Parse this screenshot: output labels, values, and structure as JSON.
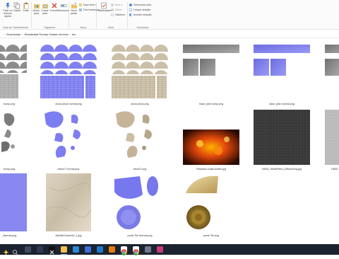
{
  "ribbon": {
    "clipboard": {
      "pin_label": "Fixar no\nAcesso\nrápido",
      "copy_label": "Copiar",
      "paste_label": "Colar",
      "group_label": "Área de Transferência"
    },
    "organize": {
      "move_to": "Mover\npara",
      "copy_to": "Copiar\npara",
      "delete": "Excluir",
      "rename": "Renomear",
      "group_label": "Organizar"
    },
    "new": {
      "new_folder": "Nova\npasta",
      "new_item": "Novo item ▾",
      "easy_access": "Fácil acesso ▾",
      "group_label": "Novo"
    },
    "open": {
      "properties": "Propriedades",
      "open": "Abrir ▾",
      "edit": "Editar",
      "history": "Histórico",
      "group_label": "Abrir"
    },
    "select": {
      "select_all": "Selecionar tudo",
      "select_none": "Limpar seleção",
      "invert": "Inverter seleção",
      "group_label": "Selecionar"
    }
  },
  "breadcrumbs": [
    "Downloads",
    "Residential Roman Garden Archviz",
    "tex"
  ],
  "files": [
    {
      "name": "bump.png",
      "kind": "arch-gray"
    },
    {
      "name": "arcos pisos normal.png",
      "kind": "arch-normal"
    },
    {
      "name": "arcos pisos.png",
      "kind": "arch-beige"
    },
    {
      "name": "base_pilar bump.png",
      "kind": "pillar-gray"
    },
    {
      "name": "base_pilar normal.png",
      "kind": "pillar-normal"
    },
    {
      "name": "",
      "kind": "pillar-gray-cut"
    },
    {
      "name": "bump.png",
      "kind": "deco-gray"
    },
    {
      "name": "deco07 normal.png",
      "kind": "deco-normal"
    },
    {
      "name": "deco07.png",
      "kind": "deco-beige"
    },
    {
      "name": "Fireplace-coals-bonfire.jpg",
      "kind": "fire"
    },
    {
      "name": "KB3D_MetalPitted_DiffuseGray.jpg",
      "kind": "metal-dark"
    },
    {
      "name": "KB3D",
      "kind": "metal-light"
    },
    {
      "name": "_Normal.png",
      "kind": "marble-normal"
    },
    {
      "name": "MarbleColumns2_1.jpg",
      "kind": "marble"
    },
    {
      "name": "ponts Tile Normal.png",
      "kind": "tile-normal"
    },
    {
      "name": "ponts Tile.png",
      "kind": "tile-gold"
    }
  ],
  "taskbar": {
    "apps": [
      "start",
      "search",
      "task-view",
      "x-app",
      "files",
      "media",
      "store",
      "vscode",
      "blender",
      "chrome",
      "chrome-alt",
      "settings",
      "paint"
    ]
  }
}
